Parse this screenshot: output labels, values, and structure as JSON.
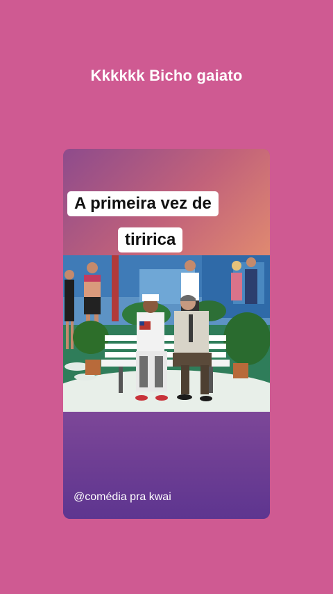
{
  "story": {
    "caption": "Kkkkkk Bicho gaiato"
  },
  "post": {
    "overlay_line_1": "A primeira vez de",
    "overlay_line_2": "tiririca",
    "handle": "@comédia pra kwai"
  },
  "colors": {
    "background": "#cf5a92",
    "card_bottom": "#6a3c92",
    "text_box": "#ffffff"
  }
}
